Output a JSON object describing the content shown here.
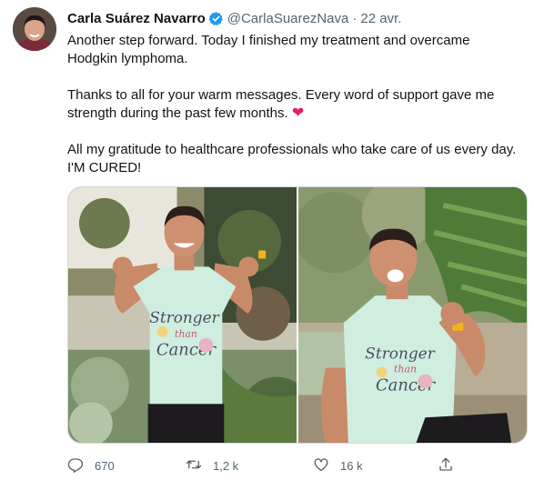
{
  "tweet": {
    "display_name": "Carla Suárez Navarro",
    "handle": "@CarlaSuarezNava",
    "separator": "·",
    "time": "22 avr.",
    "paragraphs": [
      "Another step forward. Today I finished my treatment and overcame Hodgkin lymphoma.",
      "Thanks to all for your warm messages. Every word of support gave me strength during the past few months.",
      "All my gratitude to healthcare professionals who take care of us every day. I'M CURED!"
    ],
    "shirt_text": {
      "line1": "Stronger",
      "line2": "than",
      "line3": "Cancer"
    }
  },
  "actions": {
    "replies": "670",
    "retweets": "1,2 k",
    "likes": "16 k"
  },
  "colors": {
    "verified": "#1d9bf0",
    "heart": "#e0245e",
    "secondary_text": "#536471",
    "shirt": "#cfeee0"
  },
  "icons": {
    "verified": "verified-badge-icon",
    "heart": "red-heart-emoji",
    "reply": "reply-icon",
    "retweet": "retweet-icon",
    "like": "like-icon",
    "share": "share-icon"
  }
}
